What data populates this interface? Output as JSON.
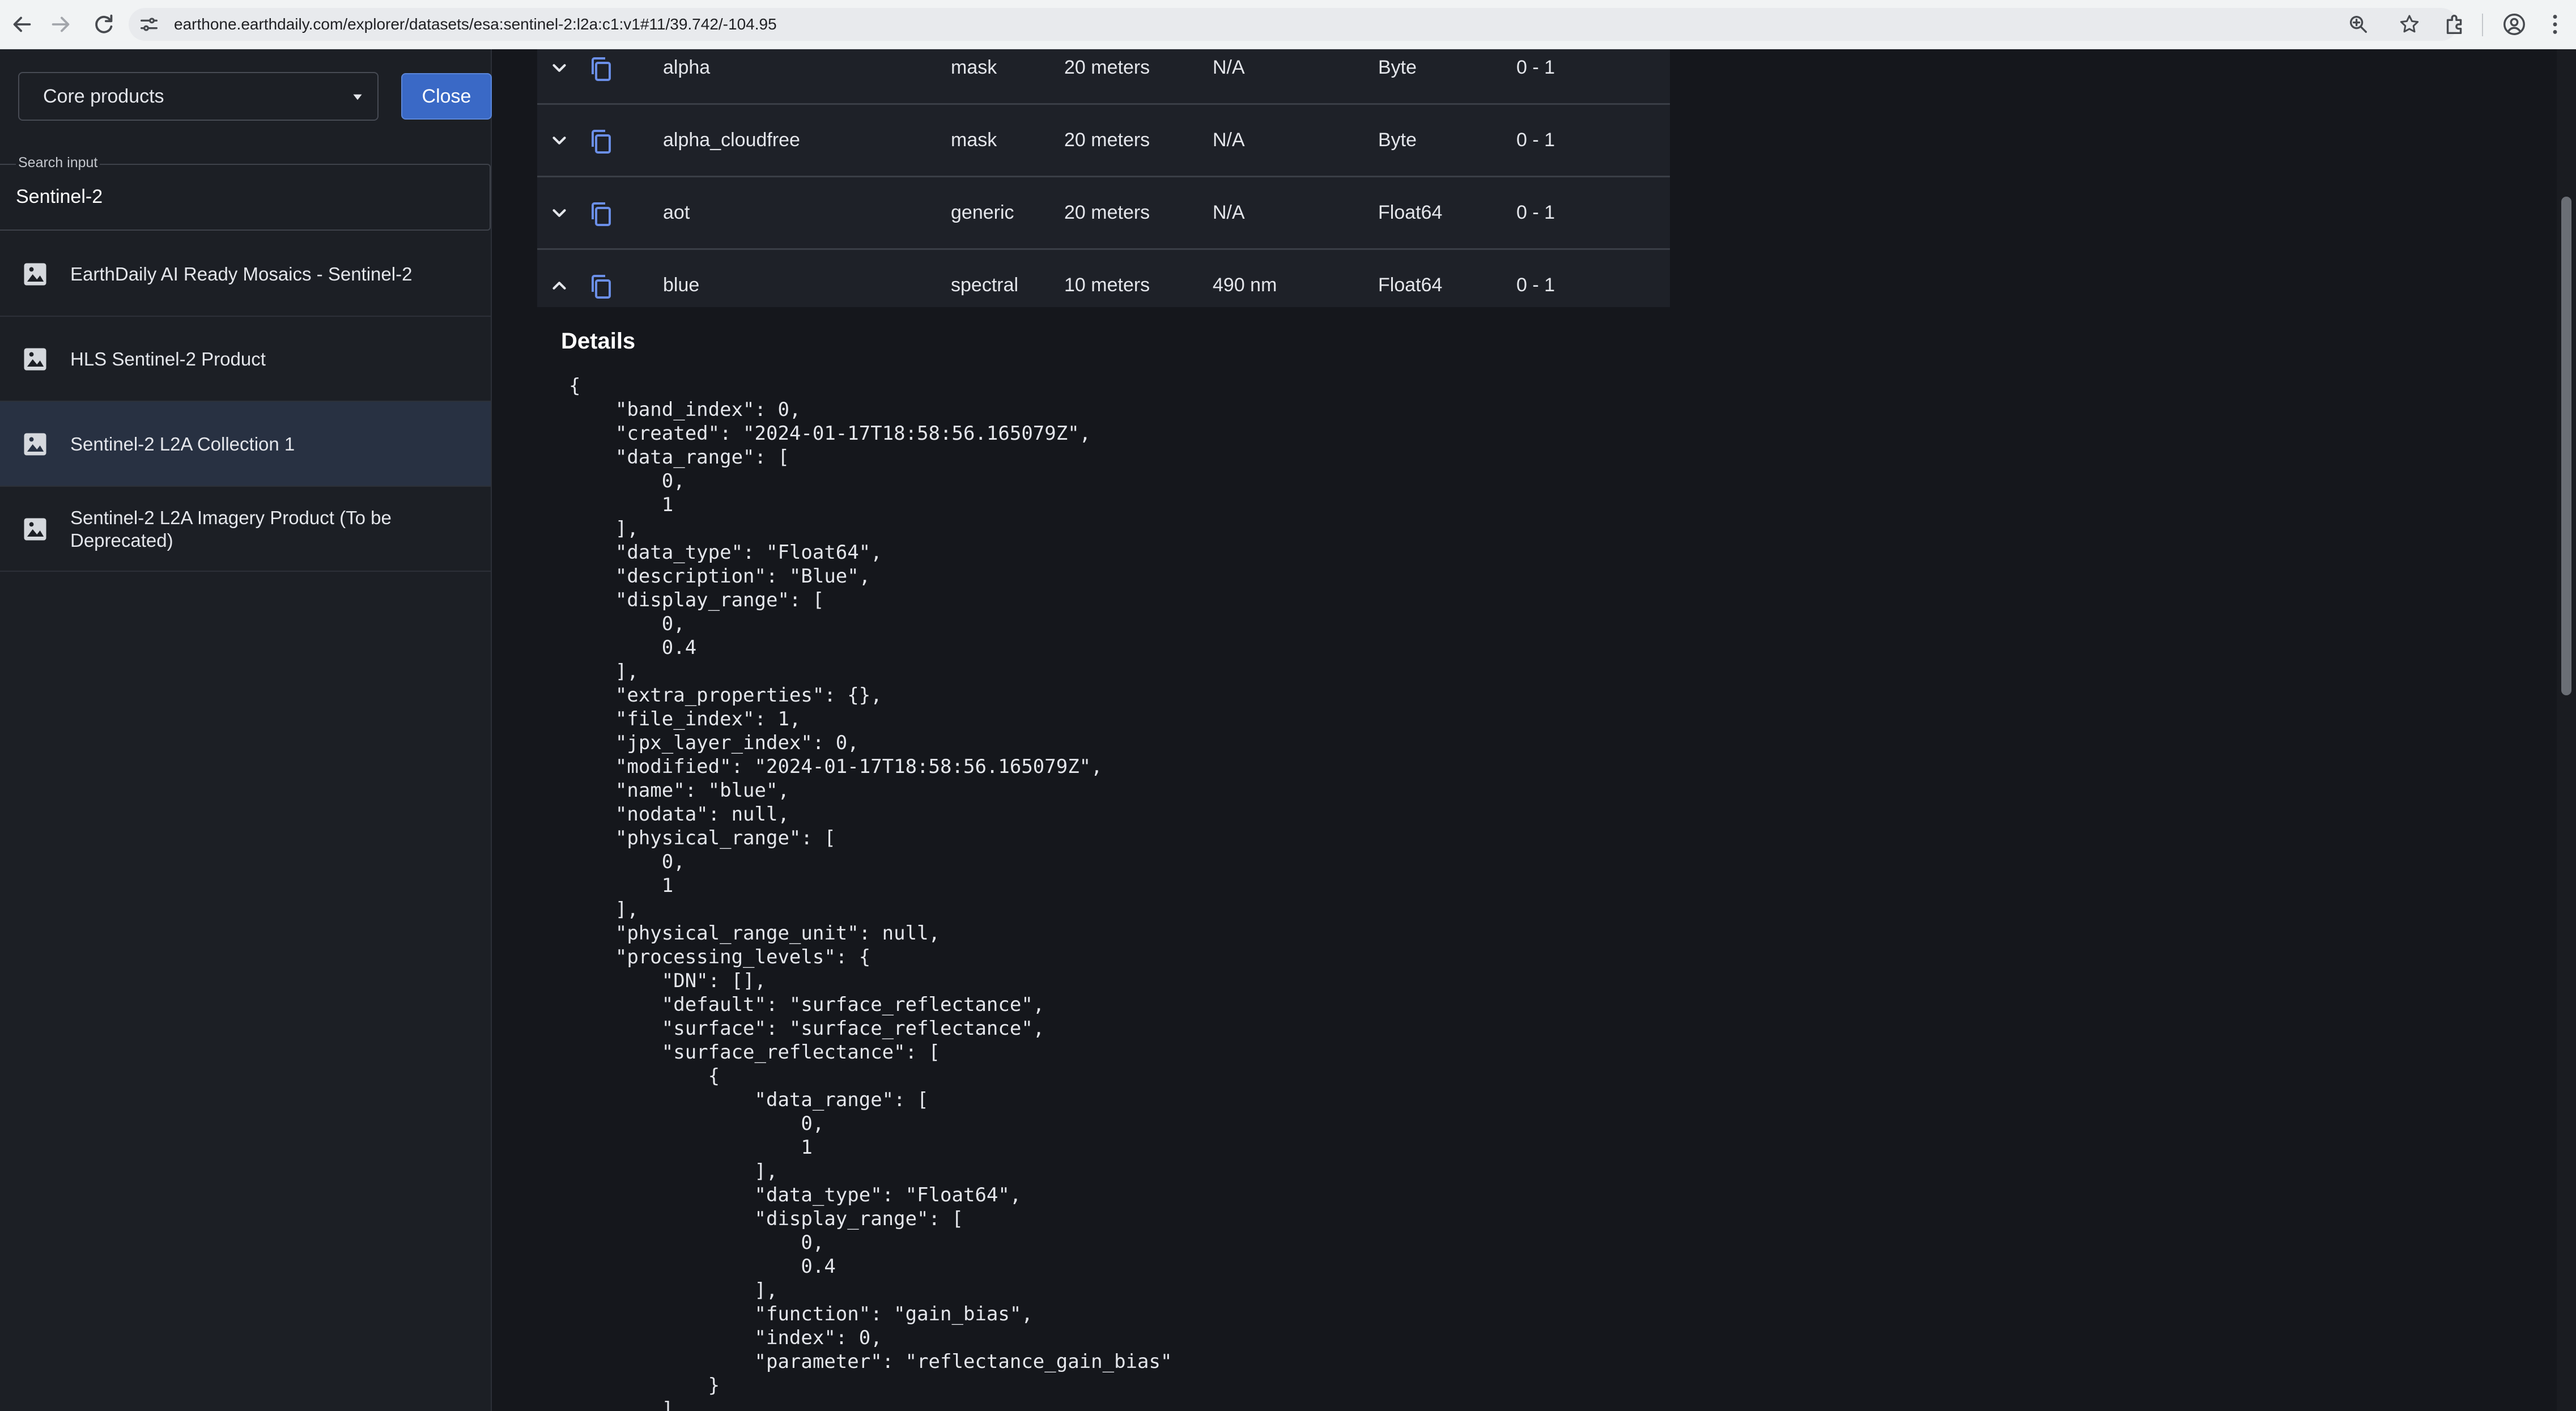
{
  "browser": {
    "url": "earthone.earthdaily.com/explorer/datasets/esa:sentinel-2:l2a:c1:v1#11/39.742/-104.95"
  },
  "sidebar": {
    "product_select": "Core products",
    "close_label": "Close",
    "search_label": "Search input",
    "search_value": "Sentinel-2",
    "results": [
      {
        "label": "EarthDaily AI Ready Mosaics - Sentinel-2"
      },
      {
        "label": "HLS Sentinel-2 Product"
      },
      {
        "label": "Sentinel-2 L2A Collection 1"
      },
      {
        "label": "Sentinel-2 L2A Imagery Product (To be Deprecated)"
      }
    ]
  },
  "bands": [
    {
      "name": "alpha",
      "type": "mask",
      "resolution": "20 meters",
      "wavelength": "N/A",
      "data_type": "Byte",
      "range": "0 - 1"
    },
    {
      "name": "alpha_cloudfree",
      "type": "mask",
      "resolution": "20 meters",
      "wavelength": "N/A",
      "data_type": "Byte",
      "range": "0 - 1"
    },
    {
      "name": "aot",
      "type": "generic",
      "resolution": "20 meters",
      "wavelength": "N/A",
      "data_type": "Float64",
      "range": "0 - 1"
    },
    {
      "name": "blue",
      "type": "spectral",
      "resolution": "10 meters",
      "wavelength": "490 nm",
      "data_type": "Float64",
      "range": "0 - 1"
    }
  ],
  "details": {
    "title": "Details",
    "json": "{\n    \"band_index\": 0,\n    \"created\": \"2024-01-17T18:58:56.165079Z\",\n    \"data_range\": [\n        0,\n        1\n    ],\n    \"data_type\": \"Float64\",\n    \"description\": \"Blue\",\n    \"display_range\": [\n        0,\n        0.4\n    ],\n    \"extra_properties\": {},\n    \"file_index\": 1,\n    \"jpx_layer_index\": 0,\n    \"modified\": \"2024-01-17T18:58:56.165079Z\",\n    \"name\": \"blue\",\n    \"nodata\": null,\n    \"physical_range\": [\n        0,\n        1\n    ],\n    \"physical_range_unit\": null,\n    \"processing_levels\": {\n        \"DN\": [],\n        \"default\": \"surface_reflectance\",\n        \"surface\": \"surface_reflectance\",\n        \"surface_reflectance\": [\n            {\n                \"data_range\": [\n                    0,\n                    1\n                ],\n                \"data_type\": \"Float64\",\n                \"display_range\": [\n                    0,\n                    0.4\n                ],\n                \"function\": \"gain_bias\",\n                \"index\": 0,\n                \"parameter\": \"reflectance_gain_bias\"\n            }\n        ]"
  },
  "colors": {
    "accent": "#3a69c6",
    "icon_blue": "#6b8fe8",
    "background": "#15171c",
    "sidebar": "#1c1f25"
  },
  "icons": {
    "back": "arrow-left-icon",
    "forward": "arrow-right-icon",
    "reload": "reload-icon",
    "site_settings": "tune-icon",
    "zoom": "zoom-icon",
    "bookmark": "star-icon",
    "extensions": "puzzle-icon",
    "profile": "profile-icon",
    "result": "image-icon",
    "expand": "chevron-down-icon",
    "collapse": "chevron-up-icon",
    "copy": "copy-icon"
  }
}
